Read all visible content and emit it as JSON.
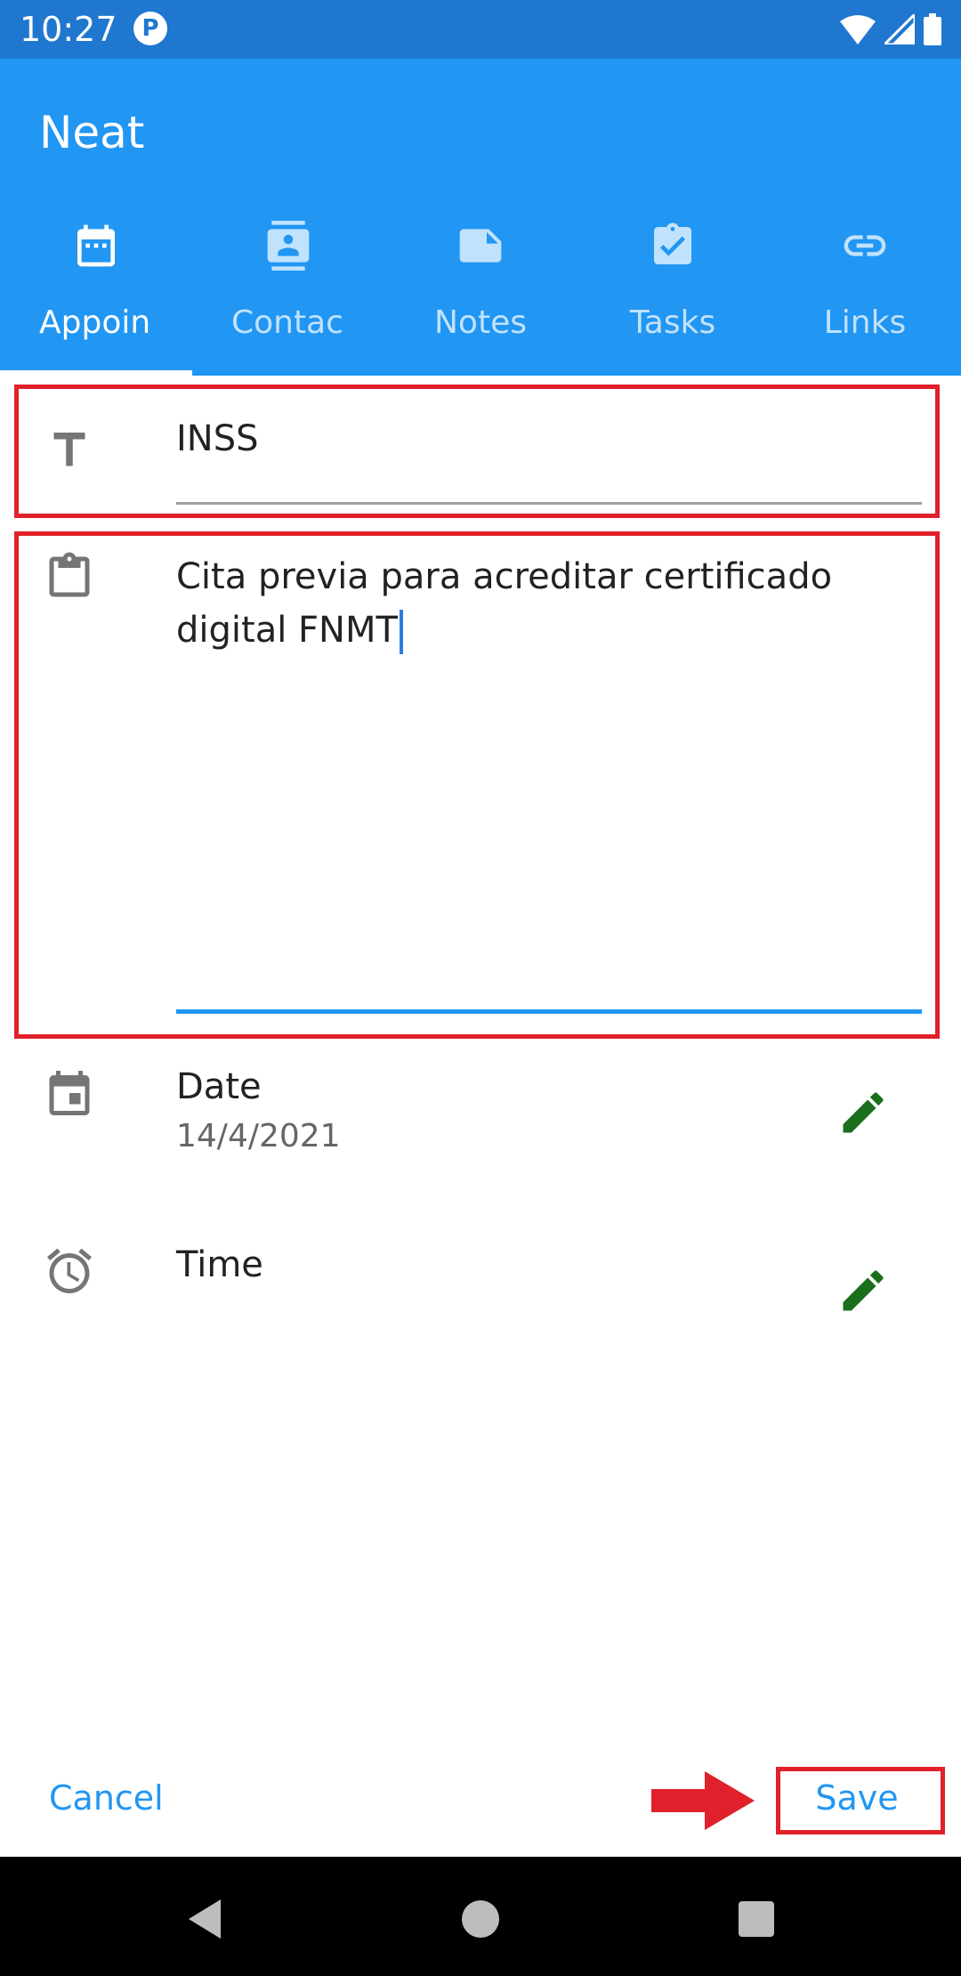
{
  "status_bar": {
    "time": "10:27",
    "notif_icon": "p-circle-icon"
  },
  "app": {
    "title": "Neat"
  },
  "tabs": [
    {
      "label": "Appoin",
      "icon": "calendar-icon",
      "selected": true
    },
    {
      "label": "Contac",
      "icon": "contact-card-icon",
      "selected": false
    },
    {
      "label": "Notes",
      "icon": "note-icon",
      "selected": false
    },
    {
      "label": "Tasks",
      "icon": "task-clipboard-icon",
      "selected": false
    },
    {
      "label": "Links",
      "icon": "link-icon",
      "selected": false
    }
  ],
  "form": {
    "title_value": "INSS",
    "description_line1": "Cita previa para acreditar certificado",
    "description_line2": "digital FNMT",
    "date_label": "Date",
    "date_value": "14/4/2021",
    "time_label": "Time"
  },
  "actions": {
    "cancel_label": "Cancel",
    "save_label": "Save"
  },
  "colors": {
    "primary": "#2196f3",
    "status_bar": "#1f77cf",
    "highlight": "#e0202a",
    "edit_icon": "#1b6e1b"
  }
}
